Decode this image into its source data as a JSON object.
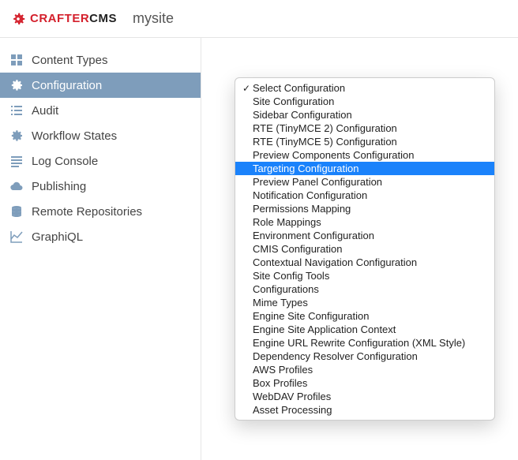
{
  "header": {
    "logo_brand_red": "CRAFTER",
    "logo_brand_black": "CMS",
    "site_name": "mysite"
  },
  "sidebar": {
    "items": [
      {
        "label": "Content Types",
        "icon": "grid-icon"
      },
      {
        "label": "Configuration",
        "icon": "gear-icon"
      },
      {
        "label": "Audit",
        "icon": "list-icon"
      },
      {
        "label": "Workflow States",
        "icon": "gear-icon"
      },
      {
        "label": "Log Console",
        "icon": "lines-icon"
      },
      {
        "label": "Publishing",
        "icon": "cloud-icon"
      },
      {
        "label": "Remote Repositories",
        "icon": "database-icon"
      },
      {
        "label": "GraphiQL",
        "icon": "chart-icon"
      }
    ],
    "active_index": 1
  },
  "dropdown": {
    "checked_index": 0,
    "selected_index": 6,
    "options": [
      "Select Configuration",
      "Site Configuration",
      "Sidebar Configuration",
      "RTE (TinyMCE 2) Configuration",
      "RTE (TinyMCE 5) Configuration",
      "Preview Components Configuration",
      "Targeting Configuration",
      "Preview Panel Configuration",
      "Notification Configuration",
      "Permissions Mapping",
      "Role Mappings",
      "Environment Configuration",
      "CMIS Configuration",
      "Contextual Navigation Configuration",
      "Site Config Tools",
      "Configurations",
      "Mime Types",
      "Engine Site Configuration",
      "Engine Site Application Context",
      "Engine URL Rewrite Configuration (XML Style)",
      "Dependency Resolver Configuration",
      "AWS Profiles",
      "Box Profiles",
      "WebDAV Profiles",
      "Asset Processing"
    ]
  }
}
